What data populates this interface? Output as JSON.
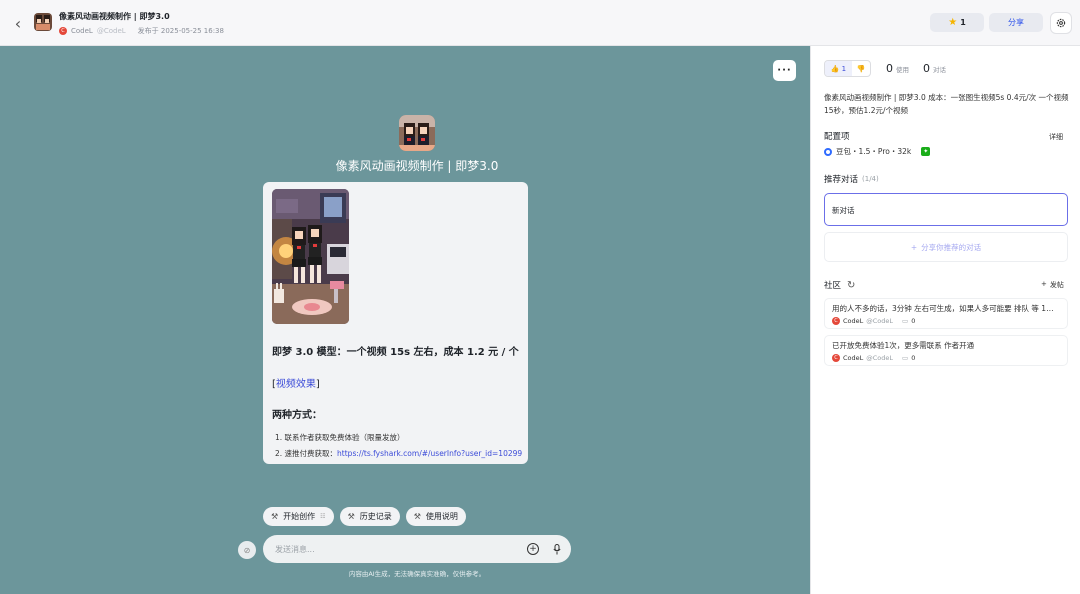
{
  "header": {
    "back_icon": "chevron-left-icon",
    "title": "像素风动画视频制作 | 即梦3.0",
    "author_name": "CodeL",
    "author_handle": "@CodeL",
    "published": "发布于 2025-05-25 16:38",
    "star_count": "1",
    "share_label": "分享",
    "settings_icon": "gear-icon"
  },
  "chat": {
    "bot_name": "像素风动画视频制作 | 即梦3.0",
    "card": {
      "heading": "即梦 3.0 模型：一个视频 15s 左右，成本 1.2 元 / 个",
      "link_open": "[",
      "link_text": "视频效果",
      "link_close": "]",
      "methods_title": "两种方式：",
      "method1": "1. 联系作者获取免费体验（限量发放）",
      "method2_prefix": "2. 速推付费获取：",
      "method2_url": "https://ts.fyshark.com/#/userInfo?user_id=10299"
    },
    "chips": [
      {
        "label": "开始创作",
        "tag": "☷"
      },
      {
        "label": "历史记录"
      },
      {
        "label": "使用说明"
      }
    ],
    "input_placeholder": "发送消息...",
    "disclaimer": "内容由AI生成，无法确保真实准确，仅供参考。"
  },
  "panel": {
    "like_count": "1",
    "usage_count": "0",
    "usage_label": "使用",
    "conv_count": "0",
    "conv_label": "对话",
    "description": "像素风动画视频制作 | 即梦3.0 成本：一张图生视频5s 0.4元/次 一个视频15秒，预估1.2元/个视频",
    "config_title": "配置项",
    "detail_label": "详细",
    "model": "豆包・1.5・Pro・32k",
    "recommend_title": "推荐对话",
    "recommend_count": "(1/4)",
    "new_chat": "新对话",
    "share_recommend": "分享你推荐的对话",
    "community_title": "社区",
    "post_label": "发帖",
    "posts": [
      {
        "text": "用的人不多的话，3分钟 左右可生成，如果人多可能要 排队 等 1…",
        "author": "CodeL",
        "handle": "@CodeL",
        "comments": "0"
      },
      {
        "text": "已开放免费体验1次，更多需联系 作者开通",
        "author": "CodeL",
        "handle": "@CodeL",
        "comments": "0"
      }
    ]
  }
}
